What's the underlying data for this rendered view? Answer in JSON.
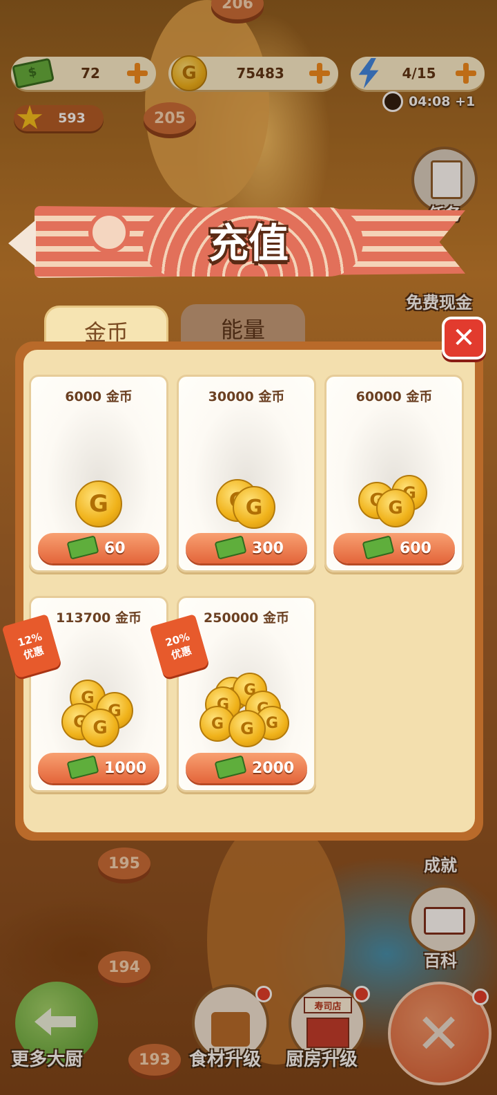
{
  "hud": {
    "cash": "72",
    "coins": "75483",
    "energy": "4/15",
    "timer": "04:08 +1",
    "stars": "593"
  },
  "map": {
    "levels": [
      "206",
      "205",
      "195",
      "194",
      "193"
    ]
  },
  "side_menu": {
    "task": "任务",
    "free_cash": "免费现金",
    "achievement": "成就",
    "encyclopedia": "百科"
  },
  "bottom_bar": {
    "more_chefs": "更多大厨",
    "ingredient_upgrade": "食材升级",
    "kitchen_upgrade": "厨房升级",
    "shop_sign": "寿司店"
  },
  "dialog": {
    "title": "充值",
    "tabs": [
      {
        "label": "金币",
        "active": true
      },
      {
        "label": "能量",
        "active": false
      }
    ],
    "products": [
      {
        "title": "6000 金币",
        "price": "60"
      },
      {
        "title": "30000 金币",
        "price": "300"
      },
      {
        "title": "60000 金币",
        "price": "600"
      },
      {
        "title": "113700 金币",
        "price": "1000",
        "badge_pct": "12%",
        "badge_text": "优惠"
      },
      {
        "title": "250000 金币",
        "price": "2000",
        "badge_pct": "20%",
        "badge_text": "优惠"
      }
    ]
  },
  "colors": {
    "accent_orange": "#f08a1d",
    "buy_button": "#e3653a",
    "close_red": "#e23b2e",
    "panel_bg": "#f3dfae"
  }
}
